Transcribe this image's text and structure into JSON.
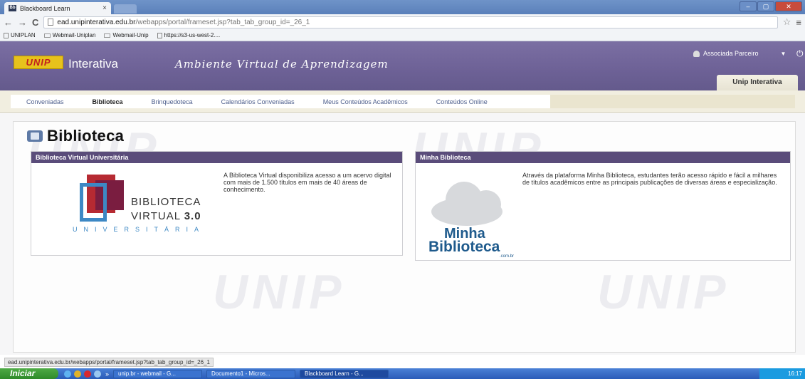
{
  "browser": {
    "tab_title": "Blackboard Learn",
    "tab_close": "×",
    "url_host": "ead.unipinterativa.edu.br",
    "url_path": "/webapps/portal/frameset.jsp?tab_tab_group_id=_26_1",
    "bookmarks": [
      "UNIPLAN",
      "Webmail-Uniplan",
      "Webmail-Unip",
      "https://s3-us-west-2...."
    ],
    "status_url": "ead.unipinterativa.edu.br/webapps/portal/frameset.jsp?tab_tab_group_id=_26_1"
  },
  "header": {
    "logo_text": "UNIP",
    "brand": "Interativa",
    "tagline": "Ambiente Virtual de Aprendizagem",
    "user": "Associada Parceiro",
    "top_tab": "Unip Interativa"
  },
  "subnav": {
    "items": [
      "Conveniadas",
      "Biblioteca",
      "Brinquedoteca",
      "Calendários Conveniadas",
      "Meus Conteúdos Acadêmicos",
      "Conteúdos Online"
    ],
    "active": "Biblioteca"
  },
  "page": {
    "title": "Biblioteca"
  },
  "modules": [
    {
      "heading": "Biblioteca Virtual Universitária",
      "text": "A Biblioteca Virtual disponibiliza acesso a um acervo digital com mais de 1.500 títulos em mais de 40 áreas de conhecimento.",
      "logo_line1": "BIBLIOTECA",
      "logo_line2": "VIRTUAL",
      "logo_version": "3.0",
      "logo_line3": "UNIVERSITÁRIA"
    },
    {
      "heading": "Minha Biblioteca",
      "text": "Através da plataforma Minha Biblioteca, estudantes terão acesso rápido e fácil a milhares de títulos acadêmicos entre as principais publicações de diversas áreas e especialização.",
      "logo_word1": "Minha",
      "logo_word2": "Biblioteca",
      "logo_suffix": ".com.br"
    }
  ],
  "taskbar": {
    "start": "Iniciar",
    "buttons": [
      "unip.br - webmail - G...",
      "Documento1 - Micros...",
      "Blackboard Learn - G..."
    ],
    "clock": "16:17"
  },
  "icons": {
    "back": "back-arrow-icon",
    "forward": "forward-arrow-icon",
    "reload": "reload-icon",
    "star": "star-icon",
    "menu": "menu-icon"
  }
}
